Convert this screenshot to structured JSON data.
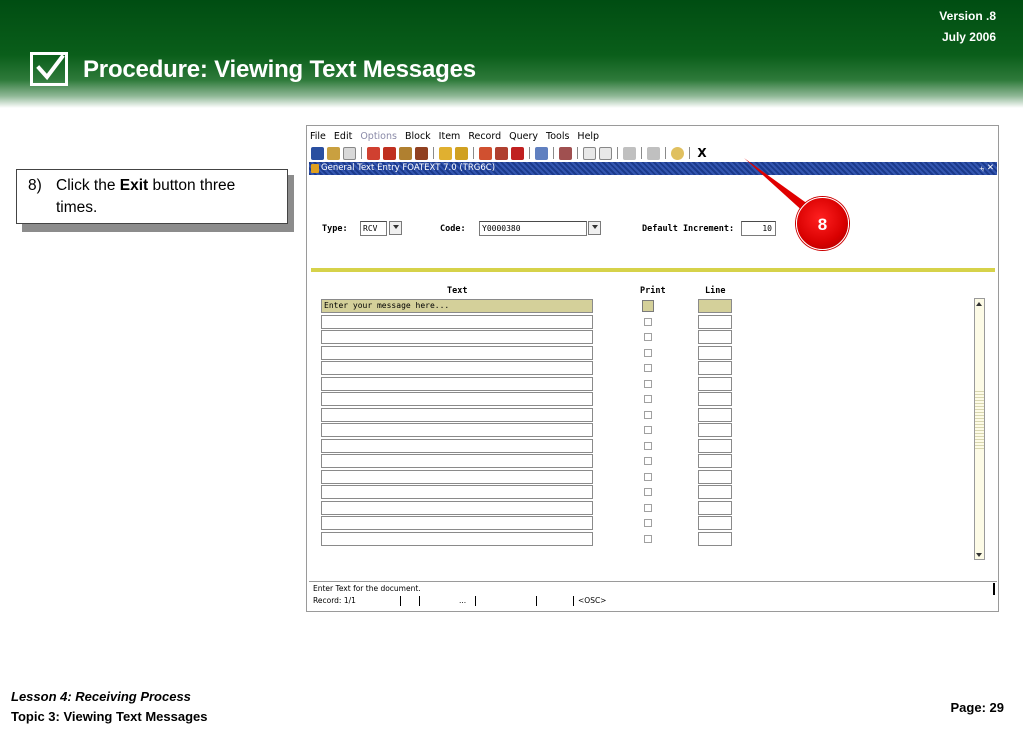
{
  "slide": {
    "title": "Procedure: Viewing Text Messages",
    "version_line1": "Version .8",
    "version_line2": "July  2006",
    "logo_icon": "checkbox-check-icon"
  },
  "instruction": {
    "number": "8)",
    "prefix": "Click the ",
    "bold": "Exit",
    "suffix": " button three times."
  },
  "app": {
    "menu": [
      {
        "label": "File",
        "enabled": true
      },
      {
        "label": "Edit",
        "enabled": true
      },
      {
        "label": "Options",
        "enabled": false
      },
      {
        "label": "Block",
        "enabled": true
      },
      {
        "label": "Item",
        "enabled": true
      },
      {
        "label": "Record",
        "enabled": true
      },
      {
        "label": "Query",
        "enabled": true
      },
      {
        "label": "Tools",
        "enabled": true
      },
      {
        "label": "Help",
        "enabled": true
      }
    ],
    "toolbar_exit_label": "X",
    "form_title": "General Text Entry  FOATEXT  7.0  (TRG6C)",
    "window_controls": "⨧ ✕",
    "type_label": "Type:",
    "type_value": "RCV",
    "code_label": "Code:",
    "code_value": "Y0000380",
    "increment_label": "Default Increment:",
    "increment_value": "10",
    "col_text": "Text",
    "col_print": "Print",
    "col_line": "Line",
    "first_row_text": "Enter your message here...",
    "status_message": "Enter Text for the document.",
    "status_record": "Record: 1/1",
    "status_dots": "...",
    "status_mode": "<OSC>"
  },
  "callout": {
    "number": "8",
    "color": "#e00000"
  },
  "footer": {
    "lesson": "Lesson 4: Receiving Process",
    "topic": "Topic 3: Viewing Text Messages",
    "page": "Page: 29"
  },
  "colors": {
    "banner_green": "#0a5e1a",
    "title_bar_blue": "#1b3a8c",
    "active_field": "#d4d09a",
    "divider_yellow": "#d6d24a"
  }
}
